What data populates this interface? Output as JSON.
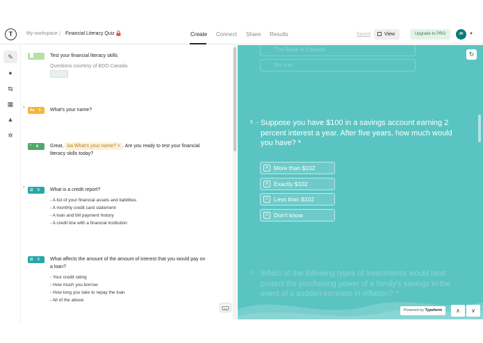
{
  "header": {
    "logo": "T",
    "workspace": "My workspace",
    "separator": "/",
    "form_title": "Financial Literacy Quiz",
    "tabs": [
      "Create",
      "Connect",
      "Share",
      "Results"
    ],
    "active_tab": "Create",
    "saved_label": "Saved",
    "view_label": "View",
    "upgrade_label": "Upgrade to PRO",
    "avatar_initials": "JK",
    "avatar_color": "#0b7a75"
  },
  "rail": {
    "icons": [
      "edit-icon",
      "drop-icon",
      "logic-icon",
      "calculator-icon",
      "bell-icon",
      "settings-icon"
    ]
  },
  "builder": {
    "welcome": {
      "title": "Test your financial literacy skills",
      "subtitle": "Questions courtesy of BDO Canada"
    },
    "q1": {
      "badge": "1",
      "text": "What's your name?",
      "color": "#f2b63a"
    },
    "q2": {
      "badge": "A",
      "prefix": "Great,",
      "recall": "What's your name?",
      "suffix": ". Are you ready to test your financial",
      "line2": "literacy skills today?",
      "color": "#52a86a"
    },
    "q3": {
      "badge": "3",
      "text": "What is a credit report?",
      "options": [
        "- A list of your financial assets and liabilities",
        "- A monthly credit card statement",
        "- A loan and bill payment history",
        "- A credit line with a financial institution"
      ],
      "color": "#26a7a8"
    },
    "q4": {
      "badge": "3",
      "text_line1": "What affects the amount of the amount of interest that you would pay on",
      "text_line2": "a loan?",
      "options": [
        "- Your credit rating",
        "- How much you borrow",
        "- How long you take to repay the loan",
        "- All of the above"
      ],
      "color": "#26a7a8"
    }
  },
  "preview": {
    "bg_color": "#5ac4c2",
    "ghost_choices": [
      "The Bank of Canada",
      "No one"
    ],
    "question_number": "5 →",
    "question": "Suppose you have $100 in a savings account earning 2 percent interest a year. After five years, how much would you have? *",
    "choices": [
      {
        "key": "A",
        "label": "More than $102"
      },
      {
        "key": "B",
        "label": "Exactly $102"
      },
      {
        "key": "C",
        "label": "Less than $102"
      },
      {
        "key": "D",
        "label": "Don't know"
      }
    ],
    "next_number": "6 →",
    "next_question": "Which of the following types of investments would best protect the purchasing power of a family's savings in the event of a sudden increase in inflation? *",
    "powered_prefix": "Powered by",
    "powered_brand": "Typeform",
    "nav_up": "∧",
    "nav_down": "∨",
    "refresh": "↻"
  }
}
